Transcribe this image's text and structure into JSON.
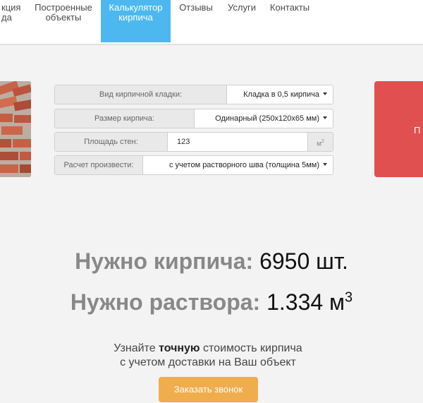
{
  "nav": {
    "items": [
      {
        "lines": [
          "кция",
          "да"
        ]
      },
      {
        "lines": [
          "Построенные",
          "объекты"
        ]
      },
      {
        "lines": [
          "Калькулятор",
          "кирпича"
        ],
        "active": true
      },
      {
        "lines": [
          "Отзывы"
        ]
      },
      {
        "lines": [
          "Услуги"
        ]
      },
      {
        "lines": [
          "Контакты"
        ]
      }
    ]
  },
  "colors": {
    "accent_blue": "#4db8ef",
    "red_block": "#e05050",
    "cta_orange": "#f0ad4e"
  },
  "form": {
    "masonry_type": {
      "label": "Вид кирпичной кладки:",
      "value": "Кладка в 0,5 кирпича"
    },
    "brick_size": {
      "label": "Размер кирпича:",
      "value": "Одинарный (250х120х65 мм)"
    },
    "wall_area": {
      "label": "Площадь стен:",
      "value": "123",
      "unit": "м",
      "unit_sup": "2"
    },
    "calc_mode": {
      "label": "Расчет произвести:",
      "value": "с учетом растворного шва (толщина 5мм)"
    }
  },
  "red_block": {
    "text": "П"
  },
  "results": {
    "bricks": {
      "label": "Нужно кирпича:",
      "value": "6950 шт."
    },
    "mortar": {
      "label": "Нужно раствора:",
      "value": "1.334 м",
      "sup": "3"
    }
  },
  "info": {
    "line1_before": "Узнайте ",
    "line1_bold": "точную",
    "line1_after": " стоимость кирпича",
    "line2": "с учетом доставки на Ваш объект"
  },
  "cta": {
    "label": "Заказать звонок"
  }
}
